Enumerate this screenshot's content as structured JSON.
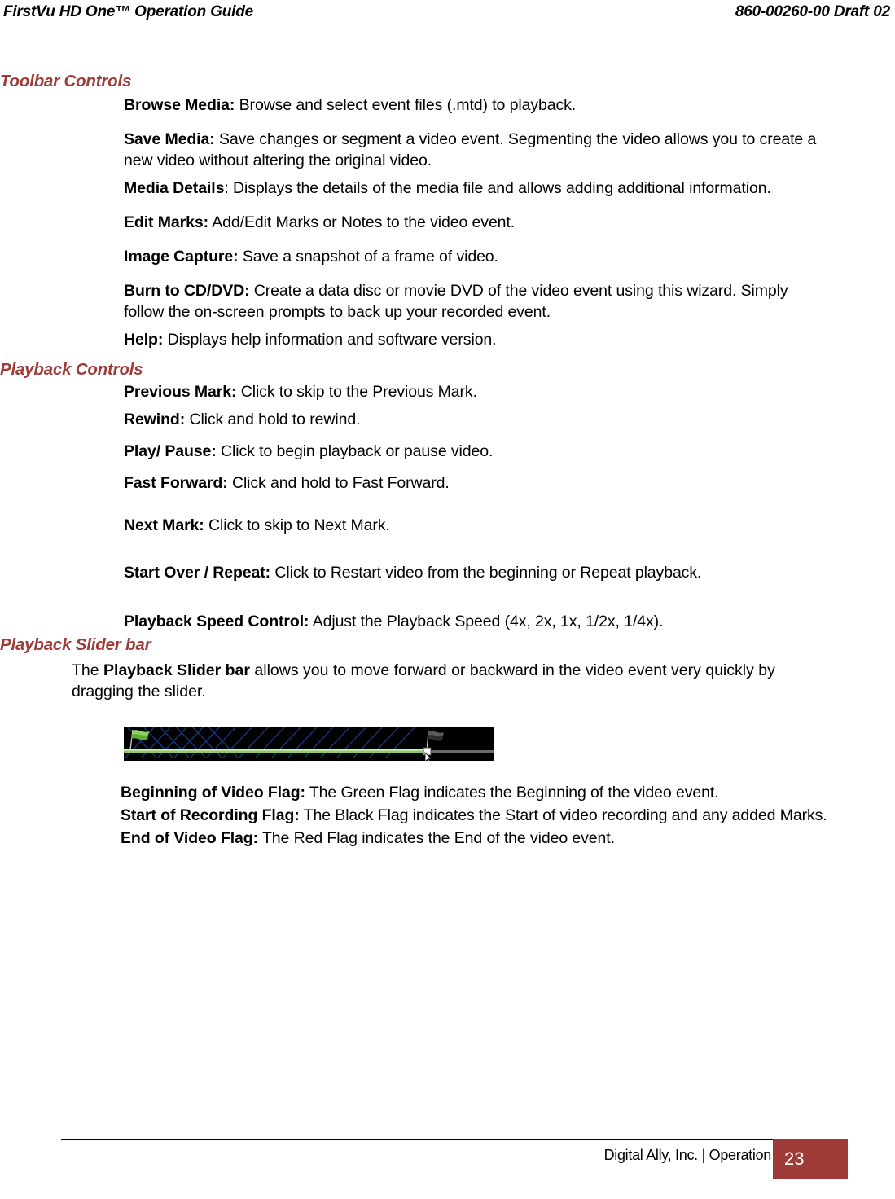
{
  "header": {
    "left": "FirstVu HD One™ Operation Guide",
    "right": "860-00260-00 Draft 02"
  },
  "colors": {
    "heading": "#9E3B38",
    "page_box": "#9E3B38",
    "text": "#000000",
    "slider_track": "#000000",
    "slider_progress": "#8CC63F",
    "slider_hatch": "#1B3C8C",
    "flag_green": "#4CA32E",
    "flag_black": "#2B2B2B",
    "flag_red": "#D01B1B"
  },
  "sections": {
    "toolbar": {
      "heading": "Toolbar Controls",
      "items": [
        {
          "icon": "browse-media-folder-icon",
          "label": "Browse Media:",
          "description": " Browse and select event files (.mtd) to playback."
        },
        {
          "icon": "save-media-floppy-icon",
          "label": "Save Media:",
          "description": " Save changes or segment a video event. Segmenting the video allows you to create a new video without altering the original video."
        },
        {
          "icon": "media-details-card-icon",
          "label": "Media Details",
          "description": ": Displays the details of the media file and allows adding additional information."
        },
        {
          "icon": "edit-marks-flag-pencil-icon",
          "label": "Edit Marks:",
          "description": " Add/Edit Marks or Notes to the video event."
        },
        {
          "icon": "image-capture-camera-icon",
          "label": "Image Capture:",
          "description": " Save a snapshot of a frame of video."
        },
        {
          "icon": "burn-to-cd-dvd-disc-icon",
          "label": "Burn to CD/DVD:",
          "description": " Create a data disc or movie DVD of the video event using this wizard. Simply follow the on-screen prompts to back up your recorded event."
        },
        {
          "icon": "help-book-icon",
          "label": "Help:",
          "description": " Displays help information and software version."
        }
      ]
    },
    "playback": {
      "heading": "Playback Controls",
      "items": [
        {
          "icon": "previous-mark-button-icon",
          "label": "Previous Mark:",
          "description": " Click to skip to the Previous Mark."
        },
        {
          "icon": "rewind-button-icon",
          "label": "Rewind:",
          "description": " Click and hold to rewind."
        },
        {
          "icon": "play-pause-button-icon",
          "label": "Play/ Pause:",
          "description": " Click to begin playback or pause video."
        },
        {
          "icon": "fast-forward-button-icon",
          "label": "Fast Forward:",
          "description": " Click and hold to Fast Forward."
        },
        {
          "icon": "next-mark-button-icon",
          "label": "Next Mark:",
          "description": " Click to skip to Next Mark."
        },
        {
          "icon": "start-over-repeat-button-icon",
          "label": "Start Over / Repeat:",
          "description": " Click to Restart video from the beginning or Repeat playback."
        },
        {
          "icon": "playback-speed-control-button-icon",
          "label": "Playback Speed Control:",
          "description": " Adjust the Playback Speed (4x, 2x, 1x, 1/2x, 1/4x)."
        }
      ]
    },
    "slider": {
      "heading": "Playback Slider bar",
      "paragraph_pre": "The ",
      "paragraph_bold": "Playback Slider bar",
      "paragraph_post": " allows you to move forward or backward in the video event very quickly by dragging the slider.",
      "speed_options": [
        "4x",
        "2x",
        "1x",
        "1/2x",
        "1/4x"
      ],
      "flags": [
        {
          "icon": "beginning-of-video-green-flag-icon",
          "label": "Beginning of Video Flag:",
          "description": " The Green Flag indicates the Beginning of the video event."
        },
        {
          "icon": "start-of-recording-black-flag-icon",
          "label": "Start of Recording Flag:",
          "description": " The Black Flag indicates the Start of video recording and any added Marks."
        },
        {
          "icon": "end-of-video-red-flag-icon",
          "label": "End of Video Flag:",
          "description": " The Red Flag indicates the End of the video event."
        }
      ]
    }
  },
  "footer": {
    "text": "Digital Ally, Inc. | Operation",
    "page_number": "23"
  }
}
